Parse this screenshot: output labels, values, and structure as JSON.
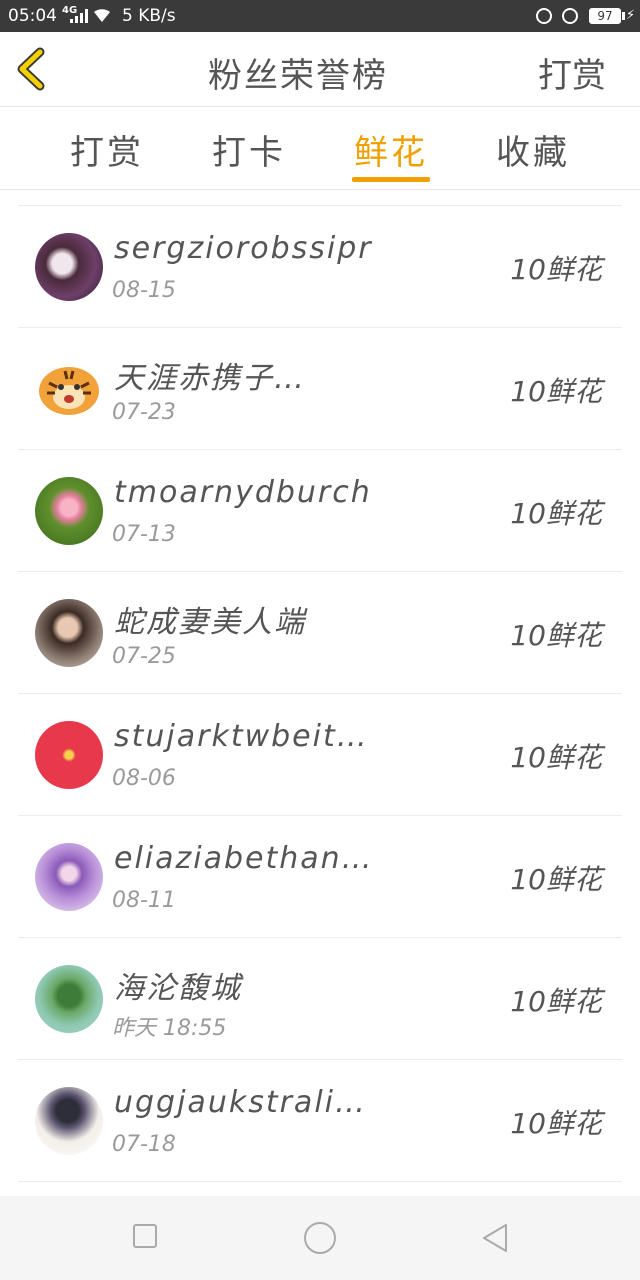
{
  "status_bar": {
    "time": "05:04",
    "network_type": "4G",
    "speed": "5 KB/s",
    "battery": "97"
  },
  "header": {
    "title": "粉丝荣誉榜",
    "action_label": "打赏"
  },
  "tabs": [
    {
      "label": "打赏",
      "active": false
    },
    {
      "label": "打卡",
      "active": false
    },
    {
      "label": "鲜花",
      "active": true
    },
    {
      "label": "收藏",
      "active": false
    }
  ],
  "accent_color": "#f0a100",
  "rows": [
    {
      "name": "sergziorobssipr",
      "date": "08-15",
      "reward": "10鲜花",
      "avatar": "girl-photo-avatar"
    },
    {
      "name": "天涯赤携子…",
      "date": "07-23",
      "reward": "10鲜花",
      "avatar": "tiger-avatar"
    },
    {
      "name": "tmoarnydburch",
      "date": "07-13",
      "reward": "10鲜花",
      "avatar": "lotus-avatar"
    },
    {
      "name": "蛇成妻美人端",
      "date": "07-25",
      "reward": "10鲜花",
      "avatar": "man-photo-avatar"
    },
    {
      "name": "stujarktwbeit…",
      "date": "08-06",
      "reward": "10鲜花",
      "avatar": "red-calligraphy-avatar"
    },
    {
      "name": "eliaziabethan…",
      "date": "08-11",
      "reward": "10鲜花",
      "avatar": "anime-girl-avatar"
    },
    {
      "name": "海沦馥城",
      "date": "昨天 18:55",
      "reward": "10鲜花",
      "avatar": "plankton-avatar"
    },
    {
      "name": "uggjaukstrali…",
      "date": "07-18",
      "reward": "10鲜花",
      "avatar": "umbrella-girl-avatar"
    }
  ]
}
